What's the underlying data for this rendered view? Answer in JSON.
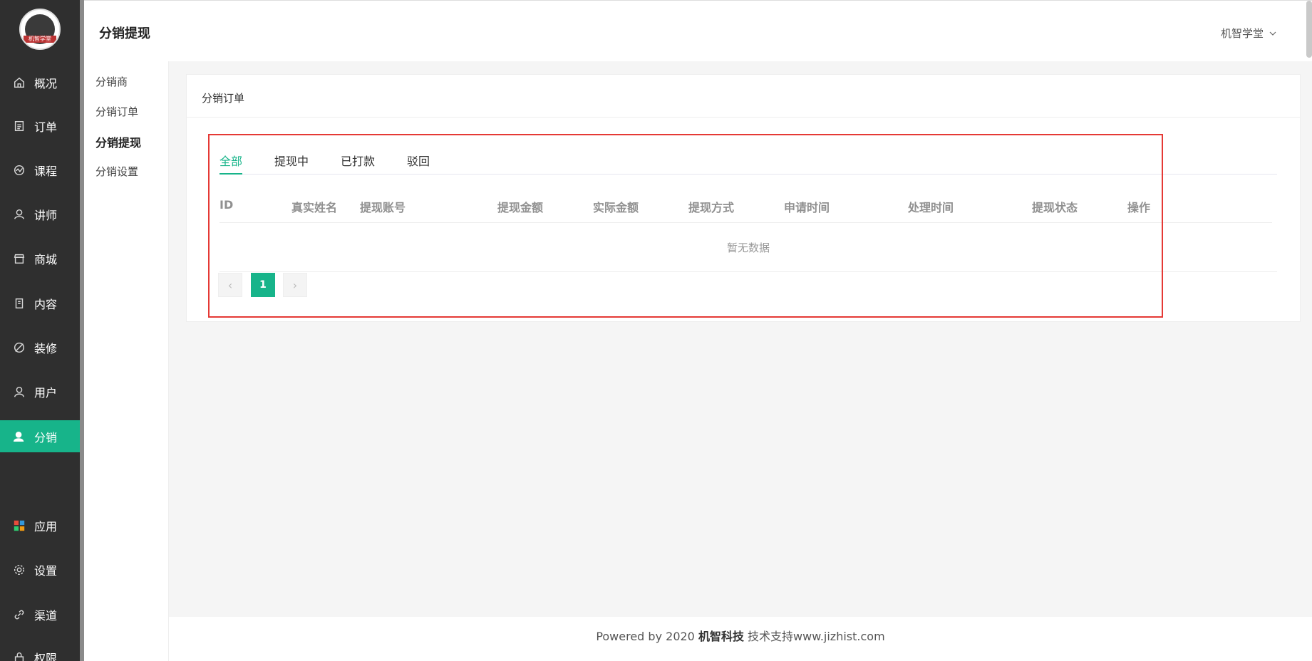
{
  "header": {
    "page_title": "分销提现",
    "user_name": "机智学堂"
  },
  "logo": {
    "text": "机智学堂"
  },
  "sidebar": {
    "items": [
      {
        "label": "概况",
        "icon": "home-icon"
      },
      {
        "label": "订单",
        "icon": "order-icon"
      },
      {
        "label": "课程",
        "icon": "course-icon"
      },
      {
        "label": "讲师",
        "icon": "teacher-icon"
      },
      {
        "label": "商城",
        "icon": "store-icon"
      },
      {
        "label": "内容",
        "icon": "content-icon"
      },
      {
        "label": "装修",
        "icon": "brush-icon"
      },
      {
        "label": "用户",
        "icon": "user-icon"
      },
      {
        "label": "分销",
        "icon": "distribution-icon",
        "active": true
      },
      {
        "label": "应用",
        "icon": "apps-icon"
      },
      {
        "label": "设置",
        "icon": "gear-icon"
      },
      {
        "label": "渠道",
        "icon": "link-icon"
      },
      {
        "label": "权限",
        "icon": "lock-icon"
      }
    ]
  },
  "subnav": {
    "items": [
      {
        "label": "分销商"
      },
      {
        "label": "分销订单"
      },
      {
        "label": "分销提现",
        "active": true
      },
      {
        "label": "分销设置"
      }
    ]
  },
  "card": {
    "title": "分销订单",
    "tabs": [
      "全部",
      "提现中",
      "已打款",
      "驳回"
    ],
    "active_tab": "全部",
    "columns": [
      "ID",
      "真实姓名",
      "提现账号",
      "提现金额",
      "实际金额",
      "提现方式",
      "申请时间",
      "处理时间",
      "提现状态",
      "操作"
    ],
    "empty_text": "暂无数据",
    "pagination": {
      "prev": "‹",
      "current": "1",
      "next": "›"
    }
  },
  "footer": {
    "prefix": "Powered by 2020 ",
    "brand": "机智科技",
    "suffix": " 技术支持www.jizhist.com"
  },
  "colors": {
    "accent": "#17b48a",
    "sidebar_bg": "#2f2f2f",
    "highlight": "#e53935"
  }
}
